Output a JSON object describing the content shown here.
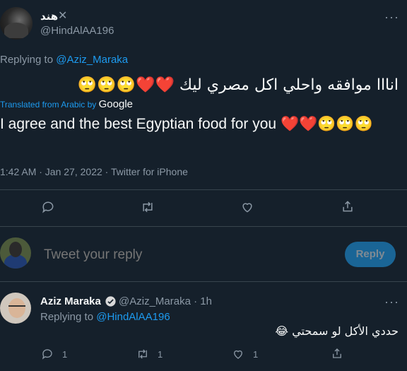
{
  "tweet": {
    "display_name": "هند",
    "handle": "@HindAlAA196",
    "replying_prefix": "Replying to ",
    "replying_to": "@Aziz_Maraka",
    "text_ar": "انااا موافقه واحلي اكل مصري ليك ❤️❤️🙄🙄🙄",
    "translated_label": "Translated from Arabic by",
    "translator": "Google",
    "translation": "I agree and the best Egyptian food for you ❤️❤️🙄🙄🙄",
    "meta": "1:42 AM · Jan 27, 2022 · Twitter for iPhone"
  },
  "reply_box": {
    "placeholder": "Tweet your reply",
    "button_label": "Reply"
  },
  "reply": {
    "display_name": "Aziz Maraka",
    "handle": "@Aziz_Maraka",
    "time": "· 1h",
    "replying_prefix": "Replying to ",
    "replying_to": "@HindAlAA196",
    "text": "حددي الأكل لو سمحتي 😂",
    "reply_count": "1",
    "retweet_count": "1",
    "like_count": "1"
  },
  "colors": {
    "background": "#15202b",
    "accent": "#1d9bf0",
    "muted": "#8b98a5",
    "heart": "#f4212e"
  },
  "icons": [
    "x-icon",
    "more-icon",
    "reply-icon",
    "retweet-icon",
    "like-icon",
    "share-icon",
    "verified-icon"
  ]
}
